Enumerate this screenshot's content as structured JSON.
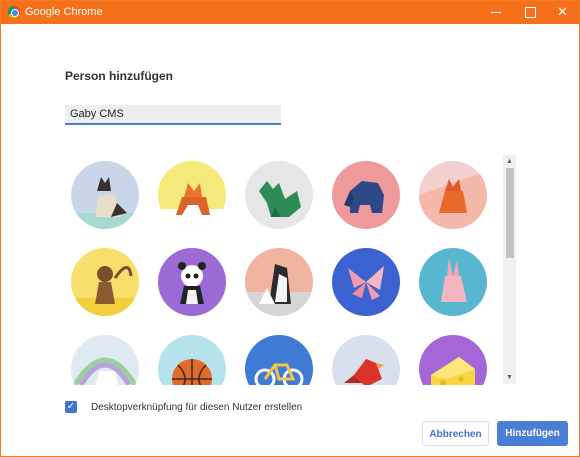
{
  "window": {
    "title": "Google Chrome",
    "minimize_icon": "minimize-icon",
    "maximize_icon": "maximize-icon",
    "close_icon": "close-icon"
  },
  "dialog": {
    "heading": "Person hinzufügen",
    "name_input_value": "Gaby CMS"
  },
  "avatars": [
    {
      "id": "cat",
      "bg": "#c9d6ea"
    },
    {
      "id": "fox",
      "bg": "#f6e97c"
    },
    {
      "id": "dragon",
      "bg": "#e6e6e6"
    },
    {
      "id": "elephant",
      "bg": "#ef9a9a"
    },
    {
      "id": "fox-2",
      "bg": "#f3d0d0"
    },
    {
      "id": "monkey",
      "bg": "#f7df6b"
    },
    {
      "id": "panda",
      "bg": "#9c6ad6"
    },
    {
      "id": "penguin",
      "bg": "#f0b4a0"
    },
    {
      "id": "butterfly",
      "bg": "#3a63d1"
    },
    {
      "id": "rabbit",
      "bg": "#58b7d0"
    },
    {
      "id": "unicorn",
      "bg": "#dfe9f2"
    },
    {
      "id": "basketball",
      "bg": "#b5e3ec"
    },
    {
      "id": "bike",
      "bg": "#3f7ad4"
    },
    {
      "id": "bird",
      "bg": "#d8e0ee"
    },
    {
      "id": "cheese",
      "bg": "#a567d8"
    }
  ],
  "checkbox": {
    "checked": true,
    "label": "Desktopverknüpfung für diesen Nutzer erstellen"
  },
  "buttons": {
    "cancel": "Abbrechen",
    "add": "Hinzufügen"
  },
  "colors": {
    "titlebar": "#f5701b",
    "accent": "#4a7ed6"
  }
}
